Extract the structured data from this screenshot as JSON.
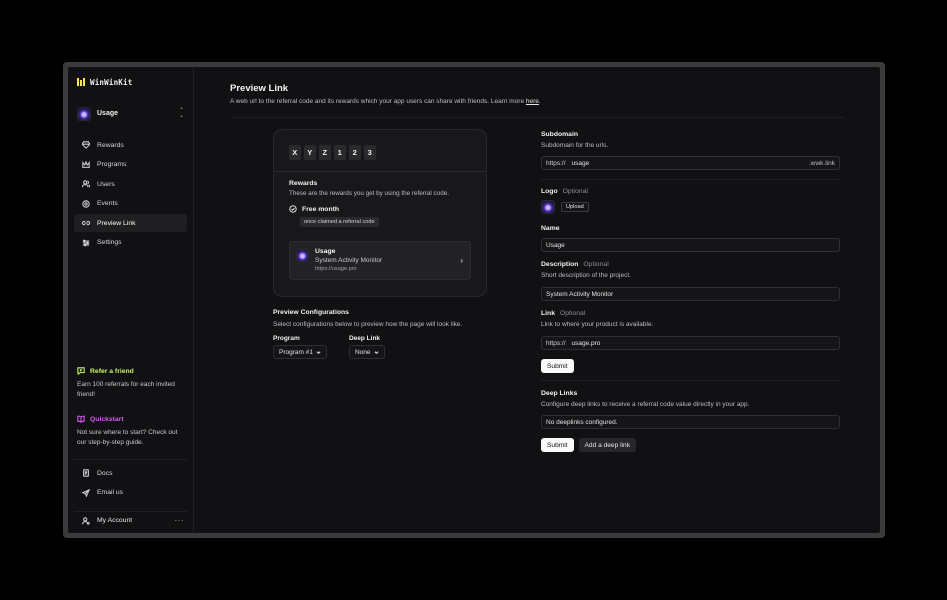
{
  "app": {
    "brand": "WinWinKit",
    "project": "Usage"
  },
  "sidebar": {
    "items": [
      {
        "id": "rewards",
        "label": "Rewards",
        "icon": "gem-icon"
      },
      {
        "id": "programs",
        "label": "Programs",
        "icon": "crown-icon"
      },
      {
        "id": "users",
        "label": "Users",
        "icon": "users-icon"
      },
      {
        "id": "events",
        "label": "Events",
        "icon": "target-icon"
      },
      {
        "id": "preview-link",
        "label": "Preview Link",
        "icon": "link-icon",
        "active": true
      },
      {
        "id": "settings",
        "label": "Settings",
        "icon": "sliders-icon"
      }
    ],
    "refer": {
      "title": "Refer a friend",
      "text": "Earn 100 referrals for each invited friend!",
      "color": "#c6f26b"
    },
    "quickstart": {
      "title": "Quickstart",
      "text": "Not sure where to start? Check out our step-by-step guide.",
      "color": "#d45cf0"
    },
    "docs": "Docs",
    "email": "Email us",
    "account": "My Account",
    "account_more": "···"
  },
  "page": {
    "title": "Preview Link",
    "description": "A web url to the referral code and its rewards which your app users can share with friends. Learn more ",
    "learn_more_link": "here",
    "description_end": "."
  },
  "preview": {
    "code": [
      "X",
      "Y",
      "Z",
      "1",
      "2",
      "3"
    ],
    "rewards_title": "Rewards",
    "rewards_desc": "These are the rewards you get by using the referral code.",
    "reward_name": "Free month",
    "reward_badge": "once claimed a referral code",
    "product_name": "Usage",
    "product_desc": "System Activity Monitor",
    "product_url": "https://usage.pro"
  },
  "config": {
    "title": "Preview Configurations",
    "desc": "Select configurations below to preview how the page will look like.",
    "program_label": "Program",
    "program_value": "Program #1",
    "deeplink_label": "Deep Link",
    "deeplink_value": "None"
  },
  "form": {
    "subdomain_label": "Subdomain",
    "subdomain_desc": "Subdomain for the urls.",
    "subdomain_prefix": "https://",
    "subdomain_value": "usage",
    "subdomain_suffix": ".wwk.link",
    "logo_label": "Logo",
    "optional": "Optional",
    "upload_label": "Upload",
    "name_label": "Name",
    "name_value": "Usage",
    "description_label": "Description",
    "description_desc": "Short description of the project.",
    "description_value": "System Activity Monitor",
    "link_label": "Link",
    "link_desc": "Link to where your product is available.",
    "link_prefix": "https://",
    "link_value": "usage.pro",
    "submit_label": "Submit",
    "deeplinks_label": "Deep Links",
    "deeplinks_desc": "Configure deep links to receive a referral code value directly in your app.",
    "deeplinks_empty": "No deeplinks configured.",
    "add_deeplink_label": "Add a deep link"
  }
}
